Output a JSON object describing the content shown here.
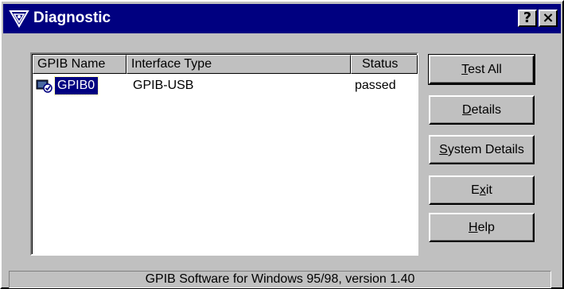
{
  "window": {
    "title": "Diagnostic",
    "help_button": "?",
    "close_button": "×",
    "colors": {
      "titlebar": "#000080",
      "face": "#c0c0c0"
    }
  },
  "list": {
    "columns": [
      "GPIB Name",
      "Interface Type",
      "Status"
    ],
    "rows": [
      {
        "name": "GPIB0",
        "interface": "GPIB-USB",
        "status": "passed",
        "icon": "gpib-board-icon"
      }
    ]
  },
  "buttons": {
    "test_all": {
      "mnemonic": "T",
      "rest": "est All"
    },
    "details": {
      "mnemonic": "D",
      "rest": "etails"
    },
    "system_details": {
      "mnemonic": "S",
      "rest": "ystem Details"
    },
    "exit": {
      "pre": "E",
      "mnemonic": "x",
      "rest": "it"
    },
    "help": {
      "mnemonic": "H",
      "rest": "elp"
    }
  },
  "status_bar": {
    "text": "GPIB Software for Windows 95/98, version 1.40"
  }
}
